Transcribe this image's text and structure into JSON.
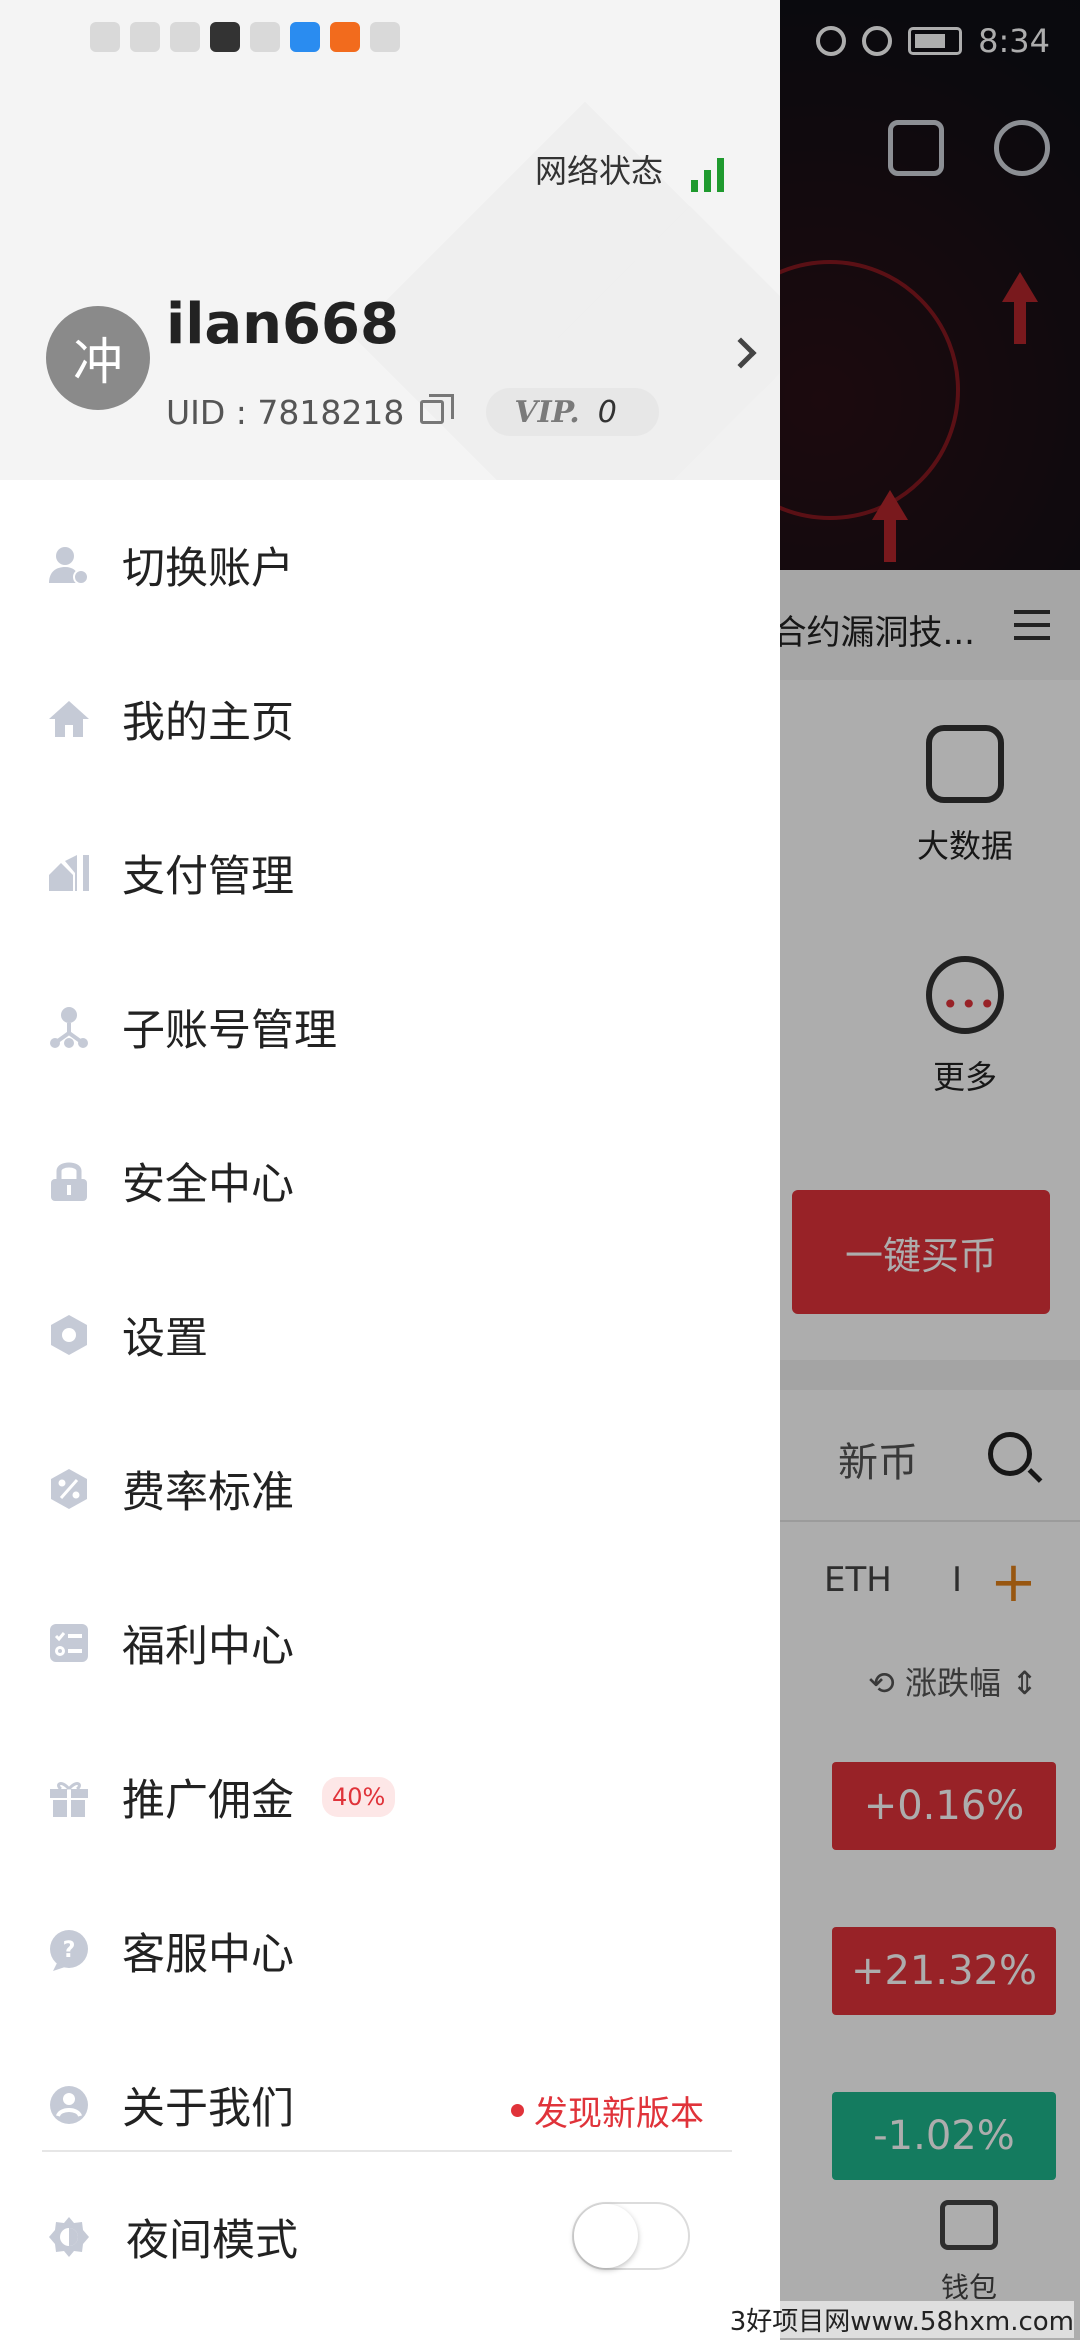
{
  "status_bar": {
    "time": "8:34"
  },
  "drawer": {
    "network_label": "网络状态",
    "user": {
      "avatar_char": "冲",
      "username": "ilan668",
      "uid": "UID : 7818218",
      "vip_mark": "VIP.",
      "vip_level": "0"
    },
    "menu": [
      {
        "label": "切换账户",
        "icon": "user-switch-icon"
      },
      {
        "label": "我的主页",
        "icon": "home-icon"
      },
      {
        "label": "支付管理",
        "icon": "payment-icon"
      },
      {
        "label": "子账号管理",
        "icon": "sub-account-icon"
      },
      {
        "label": "安全中心",
        "icon": "lock-icon"
      },
      {
        "label": "设置",
        "icon": "settings-icon"
      },
      {
        "label": "费率标准",
        "icon": "percent-icon"
      },
      {
        "label": "福利中心",
        "icon": "checklist-icon"
      },
      {
        "label": "推广佣金",
        "icon": "gift-icon",
        "tag": "40%"
      },
      {
        "label": "客服中心",
        "icon": "help-icon"
      },
      {
        "label": "关于我们",
        "icon": "about-icon",
        "notice": "发现新版本"
      }
    ],
    "night_mode": {
      "label": "夜间模式",
      "enabled": false
    }
  },
  "background": {
    "notice_text": "合约漏洞技...",
    "quick_links": [
      "大数据",
      "更多"
    ],
    "buy_button": "一键买币",
    "tab_new": "新币",
    "coins": [
      "ETH",
      "I"
    ],
    "sort_label": "涨跌幅",
    "changes": [
      "+0.16%",
      "+21.32%",
      "-1.02%"
    ],
    "wallet_label": "钱包"
  },
  "watermark": "3好项目网www.58hxm.com",
  "colors": {
    "accent_red": "#e0333a",
    "accent_green": "#1eb68c",
    "signal_green": "#1f9a2e"
  }
}
